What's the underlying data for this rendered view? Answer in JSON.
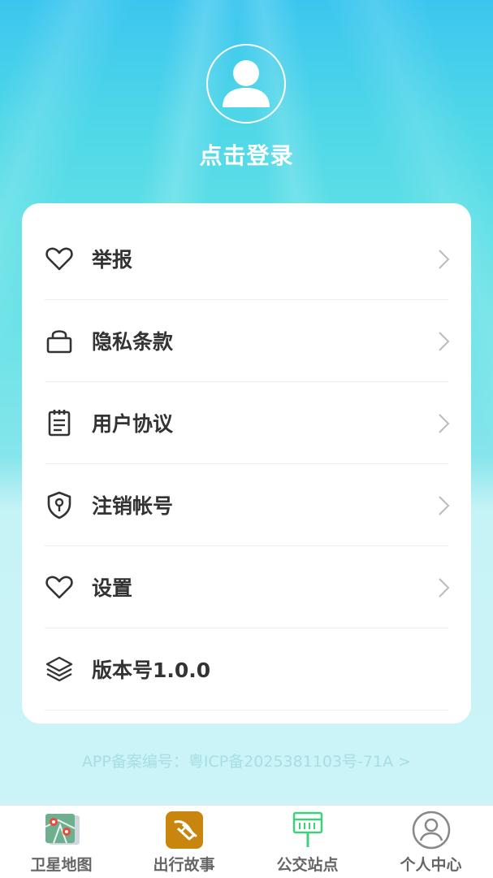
{
  "header": {
    "login_label": "点击登录"
  },
  "menu": {
    "items": [
      {
        "label": "举报",
        "icon": "heart-icon",
        "has_arrow": true
      },
      {
        "label": "隐私条款",
        "icon": "lock-icon",
        "has_arrow": true
      },
      {
        "label": "用户协议",
        "icon": "notepad-icon",
        "has_arrow": true
      },
      {
        "label": "注销帐号",
        "icon": "shield-key-icon",
        "has_arrow": true
      },
      {
        "label": "设置",
        "icon": "heart-icon",
        "has_arrow": true
      },
      {
        "label": "版本号1.0.0",
        "icon": "layers-icon",
        "has_arrow": false
      }
    ]
  },
  "footer": {
    "icp_text": "APP备案编号：粤ICP备2025381103号-71A >"
  },
  "tabbar": {
    "tabs": [
      {
        "label": "卫星地图",
        "icon": "satellite-map-icon"
      },
      {
        "label": "出行故事",
        "icon": "story-icon"
      },
      {
        "label": "公交站点",
        "icon": "bus-stop-icon"
      },
      {
        "label": "个人中心",
        "icon": "person-icon"
      }
    ]
  },
  "colors": {
    "accent": "#3cc6ef",
    "text": "#333333",
    "icp": "#a8dde2",
    "tab_label": "#666666"
  }
}
